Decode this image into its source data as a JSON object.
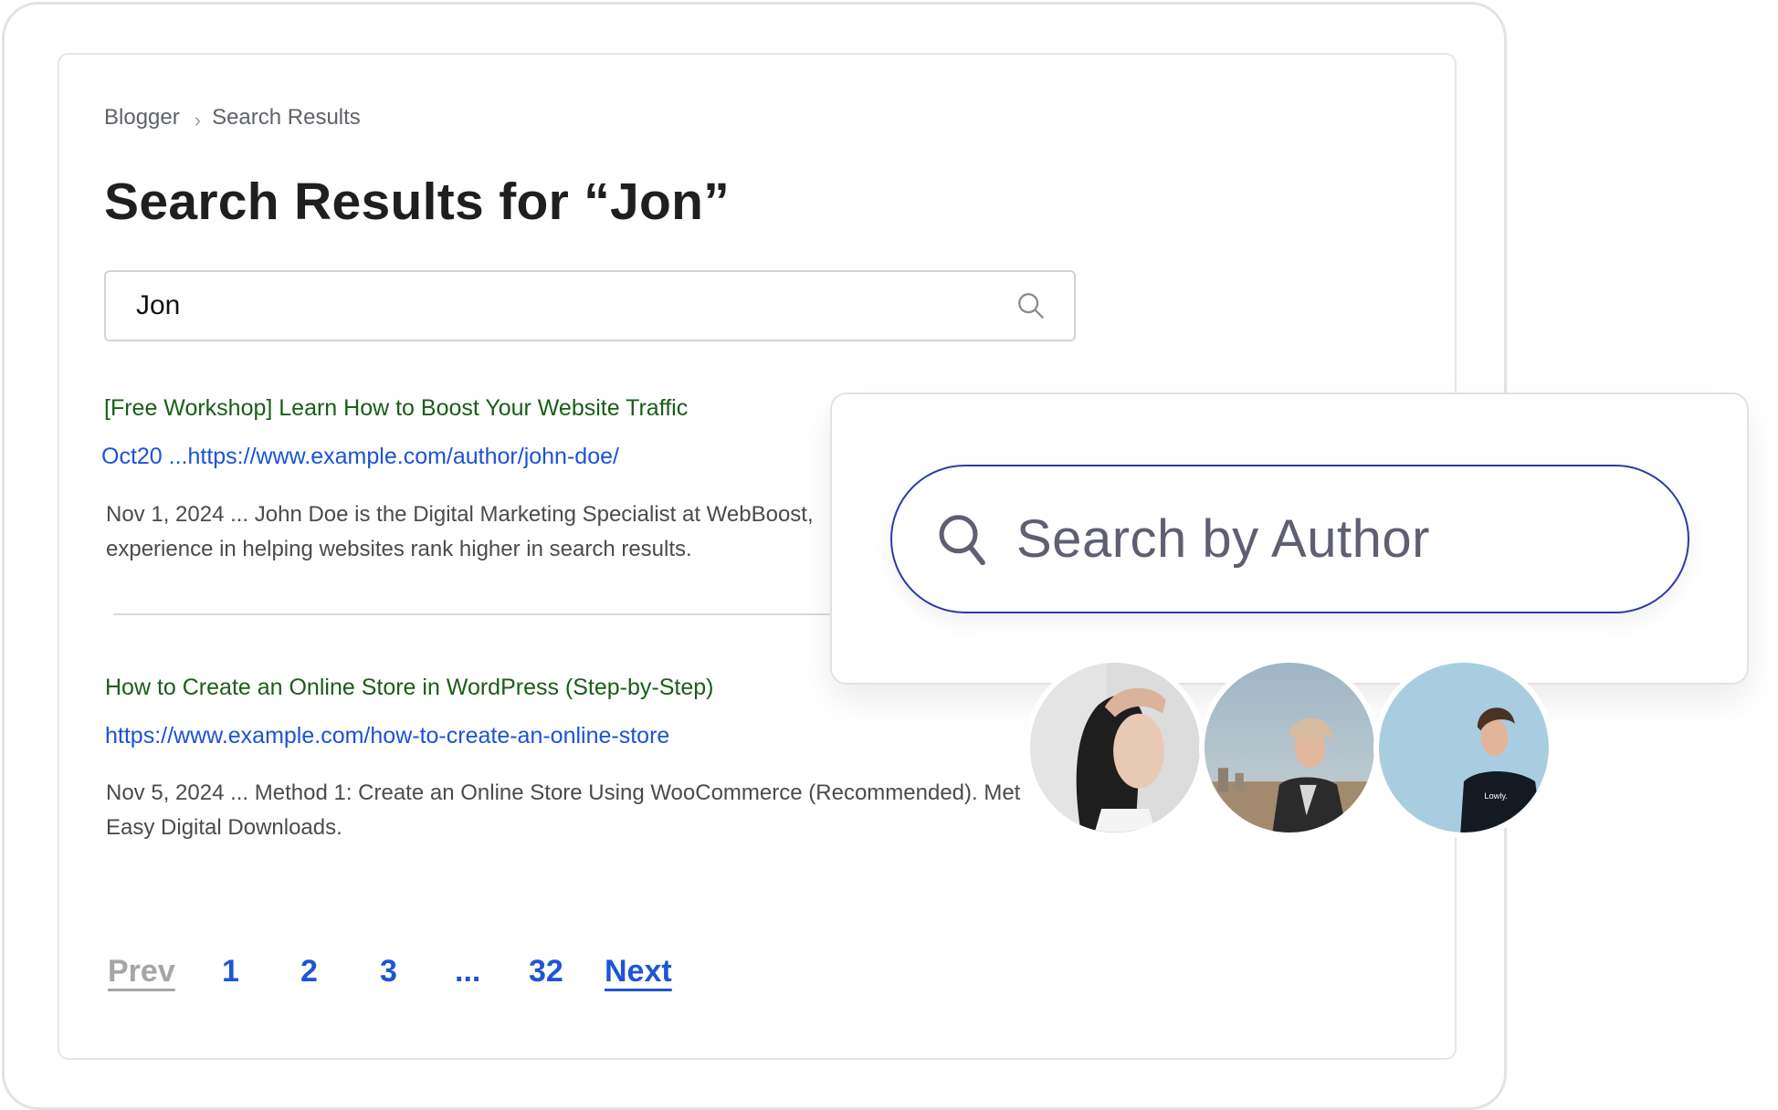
{
  "breadcrumb": {
    "items": [
      "Blogger",
      "Search Results"
    ],
    "separator": "›"
  },
  "page_title": "Search Results for “Jon”",
  "search": {
    "value": "Jon",
    "icon": "search-icon"
  },
  "results": [
    {
      "title": "[Free Workshop] Learn How to Boost Your Website Traffic",
      "url": "Oct20 ...https://www.example.com/author/john-doe/",
      "snippet_lines": [
        "Nov 1, 2024 ... John Doe is the Digital Marketing Specialist at WebBoost,",
        "experience in helping websites rank higher in search results."
      ]
    },
    {
      "title": "How to Create an Online Store in WordPress (Step-by-Step)",
      "url": "https://www.example.com/how-to-create-an-online-store",
      "snippet_lines": [
        "Nov 5, 2024 ... Method 1: Create an Online Store Using WooCommerce (Recommended). Met",
        "Easy Digital Downloads."
      ]
    }
  ],
  "pagination": {
    "prev": "Prev",
    "pages": [
      "1",
      "2",
      "3",
      "...",
      "32"
    ],
    "next": "Next"
  },
  "author_search": {
    "placeholder": "Search by Author",
    "icon": "search-icon",
    "border_color": "#2d3aa6"
  },
  "avatars": [
    {
      "name": "author-avatar-woman",
      "description": "woman with dark hair, hand on forehead"
    },
    {
      "name": "author-avatar-man-cap",
      "description": "young man in beige cap and dark jacket"
    },
    {
      "name": "author-avatar-man-tshirt",
      "description": "smiling young man in black t-shirt",
      "shirt_text": "Lowly."
    }
  ],
  "colors": {
    "result_title": "#1a5d17",
    "result_url": "#1a53d6",
    "pagination_active": "#1e55d6",
    "pagination_disabled": "#a5a5a8"
  }
}
